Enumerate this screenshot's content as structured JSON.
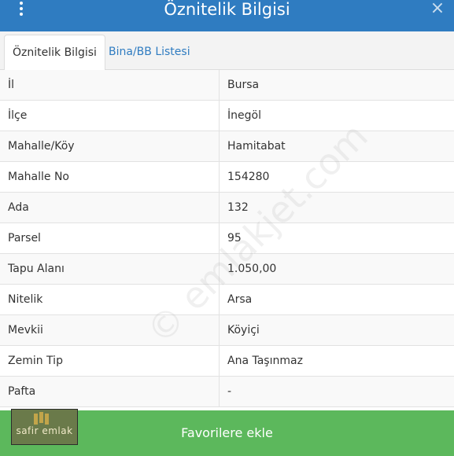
{
  "header": {
    "title": "Öznitelik Bilgisi",
    "close_glyph": "×",
    "menu_icon": "vertical-ellipsis-icon",
    "bg_color": "#2f7cc1"
  },
  "tabs": [
    {
      "label": "Öznitelik Bilgisi",
      "active": true
    },
    {
      "label": "Bina/BB Listesi",
      "active": false
    }
  ],
  "rows": [
    {
      "key": "İl",
      "value": "Bursa"
    },
    {
      "key": "İlçe",
      "value": "İnegöl"
    },
    {
      "key": "Mahalle/Köy",
      "value": "Hamitabat"
    },
    {
      "key": "Mahalle No",
      "value": "154280"
    },
    {
      "key": "Ada",
      "value": "132"
    },
    {
      "key": "Parsel",
      "value": "95"
    },
    {
      "key": "Tapu Alanı",
      "value": "1.050,00"
    },
    {
      "key": "Nitelik",
      "value": "Arsa"
    },
    {
      "key": "Mevkii",
      "value": "Köyiçi"
    },
    {
      "key": "Zemin Tip",
      "value": "Ana Taşınmaz"
    },
    {
      "key": "Pafta",
      "value": "-"
    }
  ],
  "watermark": "© emlakjet.com",
  "logo": {
    "text": "safir emlak"
  },
  "footer": {
    "label": "Favorilere ekle",
    "bg_color": "#5cb85c"
  }
}
